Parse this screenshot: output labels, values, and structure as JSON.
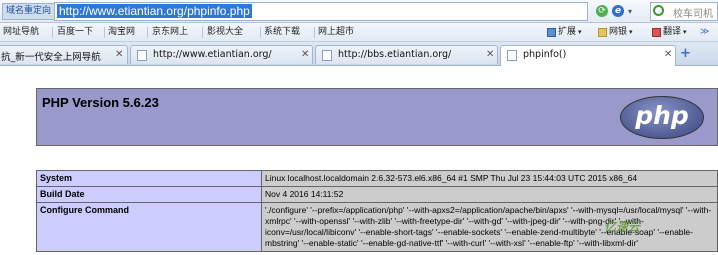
{
  "address_bar": {
    "label": "域名重定向",
    "url": "http://www.etiantian.org/phpinfo.php",
    "search_placeholder": "校车司机"
  },
  "bookmarks": [
    {
      "label": "网址导航"
    },
    {
      "label": "百度一下"
    },
    {
      "label": "淘宝网"
    },
    {
      "label": "京东网上"
    },
    {
      "label": "影视大全"
    },
    {
      "label": "系统下载"
    },
    {
      "label": "网上超市"
    }
  ],
  "toolbar_right": {
    "extensions": "扩展",
    "netbank": "网银",
    "translate": "翻译"
  },
  "tabs": [
    {
      "label": "抗_新一代安全上网导航"
    },
    {
      "label": "http://www.etiantian.org/"
    },
    {
      "label": "http://bbs.etiantian.org/"
    },
    {
      "label": "phpinfo()"
    }
  ],
  "new_tab": "+",
  "php": {
    "version_title": "PHP Version 5.6.23",
    "logo_text": "php",
    "rows": [
      {
        "key": "System",
        "value": "Linux localhost.localdomain 2.6.32-573.el6.x86_64 #1 SMP Thu Jul 23 15:44:03 UTC 2015 x86_64"
      },
      {
        "key": "Build Date",
        "value": "Nov 4 2016 14:11:52"
      },
      {
        "key": "Configure Command",
        "value": "'./configure' '--prefix=/application/php' '--with-apxs2=/application/apache/bin/apxs' '--with-mysql=/usr/local/mysql' '--with-xmlrpc' '--with-openssl' '--with-zlib' '--with-freetype-dir' '--with-gd' '--with-jpeg-dir' '--with-png-dir' '--with-iconv=/usr/local/libiconv' '--enable-short-tags' '--enable-sockets' '--enable-zend-multibyte' '--enable-soap' '--enable-mbstring' '--enable-static' '--enable-gd-native-ttf' '--with-curl' '--with-xsl' '--enable-ftp' '--with-libxml-dir'"
      }
    ]
  },
  "watermark": "亿速云"
}
